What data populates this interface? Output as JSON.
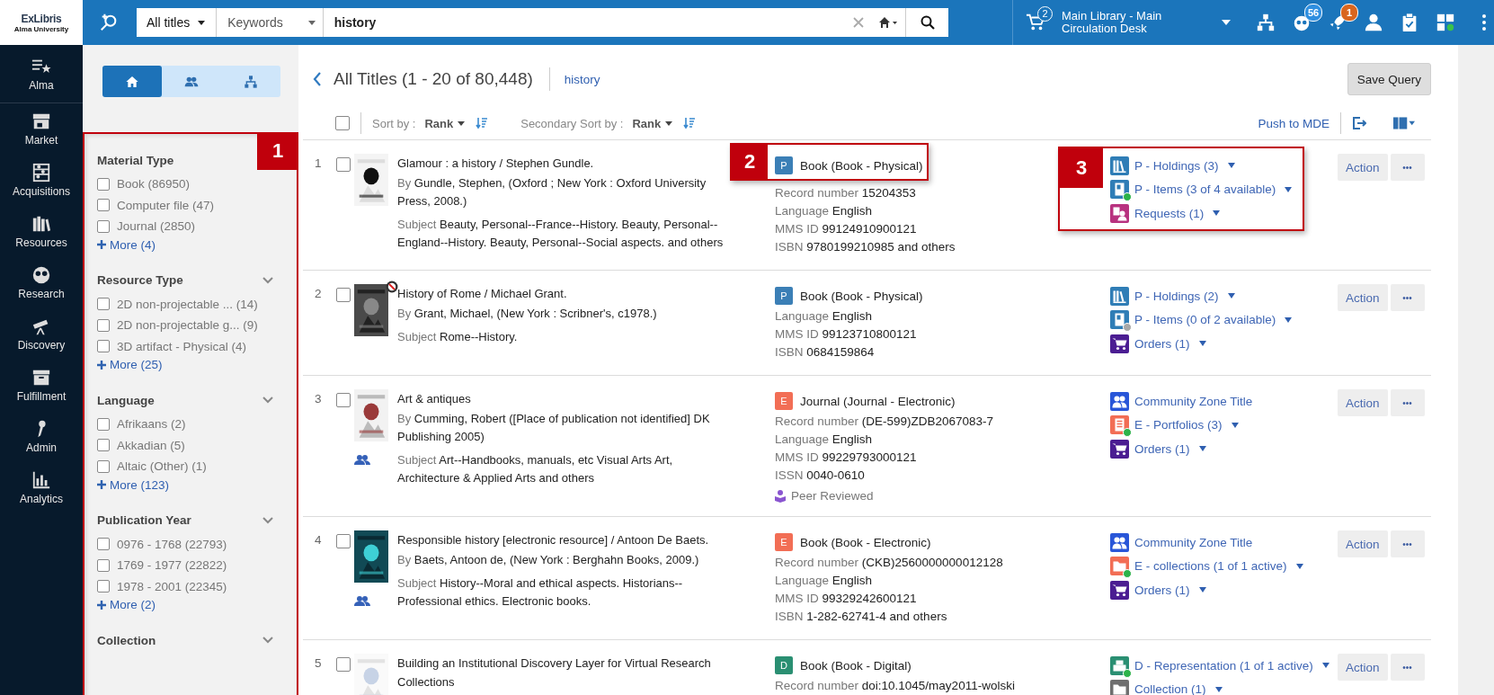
{
  "logo": {
    "brand": "ExLibris",
    "name": "Alma University"
  },
  "search": {
    "scope": "All titles",
    "field": "Keywords",
    "query": "history"
  },
  "cart": {
    "count": "2"
  },
  "location": "Main Library - Main Circulation Desk",
  "top_icons": [
    {
      "kind": "hierarchy"
    },
    {
      "kind": "avatar",
      "badge": "56"
    },
    {
      "kind": "rocket",
      "badge": "1"
    },
    {
      "kind": "person"
    },
    {
      "kind": "clipboard"
    },
    {
      "kind": "widgets"
    }
  ],
  "nav": [
    {
      "kind": "alma",
      "label": "Alma"
    },
    {
      "kind": "market",
      "label": "Market"
    },
    {
      "kind": "acquisitions",
      "label": "Acquisitions"
    },
    {
      "kind": "resources",
      "label": "Resources"
    },
    {
      "kind": "research",
      "label": "Research"
    },
    {
      "kind": "discovery",
      "label": "Discovery"
    },
    {
      "kind": "fulfillment",
      "label": "Fulfillment"
    },
    {
      "kind": "admin",
      "label": "Admin"
    },
    {
      "kind": "analytics",
      "label": "Analytics"
    }
  ],
  "scope_tabs": [
    {
      "kind": "home",
      "selected": true
    },
    {
      "kind": "people",
      "selected": false
    },
    {
      "kind": "hierarchy",
      "selected": false
    }
  ],
  "facets": {
    "callout": "1",
    "groups": [
      {
        "title": "Material Type",
        "chevron": false,
        "items": [
          {
            "label": "Book (86950)",
            "checked": false
          },
          {
            "label": "Computer file (47)",
            "checked": false
          },
          {
            "label": "Journal (2850)",
            "checked": false
          }
        ],
        "more": "More (4)"
      },
      {
        "title": "Resource Type",
        "chevron": true,
        "items": [
          {
            "label": "2D non-projectable ... (14)",
            "checked": false
          },
          {
            "label": "2D non-projectable g... (9)",
            "checked": false
          },
          {
            "label": "3D artifact - Physical (4)",
            "checked": false
          }
        ],
        "more": "More (25)"
      },
      {
        "title": "Language",
        "chevron": true,
        "items": [
          {
            "label": "Afrikaans (2)",
            "checked": false
          },
          {
            "label": "Akkadian (5)",
            "checked": false
          },
          {
            "label": "Altaic (Other) (1)",
            "checked": false
          }
        ],
        "more": "More (123)"
      },
      {
        "title": "Publication Year",
        "chevron": true,
        "items": [
          {
            "label": "0976 - 1768 (22793)",
            "checked": false
          },
          {
            "label": "1769 - 1977 (22822)",
            "checked": false
          },
          {
            "label": "1978 - 2001 (22345)",
            "checked": false
          }
        ],
        "more": "More (2)"
      },
      {
        "title": "Collection",
        "chevron": true
      }
    ]
  },
  "header": {
    "title": "All Titles (1 - 20 of 80,448)",
    "query": "history",
    "save": "Save Query"
  },
  "toolbar": {
    "select_all": false,
    "sort_label": "Sort by :",
    "sort_value": "Rank",
    "secondary_label": "Secondary Sort by :",
    "secondary_value": "Rank",
    "push": "Push to MDE"
  },
  "rows": [
    {
      "number": "1",
      "checked": false,
      "thumbnail": {
        "kind": "picture"
      },
      "blocked": false,
      "community_zone": false,
      "title": "Glamour : a history / Stephen Gundle.",
      "by_label": "By",
      "by": "Gundle, Stephen, (Oxford ; New York : Oxford University Press, 2008.)",
      "subject_label": "Subject",
      "subject": "Beauty, Personal--France--History. Beauty, Personal--England--History. Beauty, Personal--Social aspects. and others",
      "format": {
        "letter": "P",
        "color": "#3b7fb6",
        "text": "Book (Book - Physical)",
        "callout": "2"
      },
      "fields": [
        {
          "label": "Record number",
          "value": "15204353"
        },
        {
          "label": "Language",
          "value": "English"
        },
        {
          "label": "MMS ID",
          "value": "99124910900121"
        },
        {
          "label": "ISBN",
          "value": "9780199210985 and others"
        }
      ],
      "inventory_callout": "3",
      "inventory": [
        {
          "kind": "holdings",
          "text": "P - Holdings (3)",
          "dropdown": true
        },
        {
          "kind": "items",
          "text": "P - Items (3 of 4 available)",
          "dropdown": true,
          "color": "#2db34a"
        },
        {
          "kind": "requests",
          "text": "Requests (1)",
          "dropdown": true
        }
      ],
      "action": "Action",
      "more": "•••"
    },
    {
      "number": "2",
      "checked": false,
      "thumbnail": {
        "kind": "picture"
      },
      "blocked": true,
      "community_zone": false,
      "title": "History of Rome / Michael Grant.",
      "by_label": "By",
      "by": "Grant, Michael, (New York : Scribner's, c1978.)",
      "subject_label": "Subject",
      "subject": "Rome--History.",
      "format": {
        "letter": "P",
        "color": "#3b7fb6",
        "text": "Book (Book - Physical)"
      },
      "fields": [
        {
          "label": "Language",
          "value": "English"
        },
        {
          "label": "MMS ID",
          "value": "99123710800121"
        },
        {
          "label": "ISBN",
          "value": "0684159864"
        }
      ],
      "inventory": [
        {
          "kind": "holdings",
          "text": "P - Holdings (2)",
          "dropdown": true
        },
        {
          "kind": "items",
          "text": "P - Items (0 of 2 available)",
          "dropdown": true,
          "color": "#a8a8a8"
        },
        {
          "kind": "orders",
          "text": "Orders (1)",
          "dropdown": true
        }
      ],
      "action": "Action",
      "more": "•••"
    },
    {
      "number": "3",
      "checked": false,
      "thumbnail": {
        "kind": "picture"
      },
      "blocked": false,
      "community_zone": true,
      "title": "Art & antiques",
      "by_label": "By",
      "by": "Cumming, Robert ([Place of publication not identified] DK Publishing 2005)",
      "subject_label": "Subject",
      "subject": "Art--Handbooks, manuals, etc Visual Arts Art, Architecture & Applied Arts and others",
      "format": {
        "letter": "E",
        "color": "#f26e55",
        "text": "Journal (Journal - Electronic)"
      },
      "fields": [
        {
          "label": "Record number",
          "value": "(DE-599)ZDB2067083-7"
        },
        {
          "label": "Language",
          "value": "English"
        },
        {
          "label": "MMS ID",
          "value": "99229793000121"
        },
        {
          "label": "ISSN",
          "value": "0040-0610"
        }
      ],
      "peer_reviewed": "Peer Reviewed",
      "inventory": [
        {
          "kind": "community",
          "text": "Community Zone Title",
          "dropdown": false
        },
        {
          "kind": "portfolios",
          "text": "E - Portfolios (3)",
          "dropdown": true,
          "color": "#2db34a"
        },
        {
          "kind": "orders",
          "text": "Orders (1)",
          "dropdown": true
        }
      ],
      "action": "Action",
      "more": "•••"
    },
    {
      "number": "4",
      "checked": false,
      "thumbnail": {
        "kind": "picture"
      },
      "blocked": false,
      "community_zone": true,
      "title": "Responsible history [electronic resource] / Antoon De Baets.",
      "by_label": "By",
      "by": "Baets, Antoon de, (New York : Berghahn Books, 2009.)",
      "subject_label": "Subject",
      "subject": "History--Moral and ethical aspects. Historians--Professional ethics. Electronic books.",
      "format": {
        "letter": "E",
        "color": "#f26e55",
        "text": "Book (Book - Electronic)"
      },
      "fields": [
        {
          "label": "Record number",
          "value": "(CKB)2560000000012128"
        },
        {
          "label": "Language",
          "value": "English"
        },
        {
          "label": "MMS ID",
          "value": "99329242600121"
        },
        {
          "label": "ISBN",
          "value": "1-282-62741-4 and others"
        }
      ],
      "inventory": [
        {
          "kind": "community",
          "text": "Community Zone Title",
          "dropdown": false
        },
        {
          "kind": "collections",
          "text": "E - collections (1 of 1 active)",
          "dropdown": true,
          "color": "#2db34a"
        },
        {
          "kind": "orders",
          "text": "Orders (1)",
          "dropdown": true
        }
      ],
      "action": "Action",
      "more": "•••"
    },
    {
      "number": "5",
      "checked": false,
      "thumbnail": {
        "kind": "picture"
      },
      "blocked": false,
      "community_zone": false,
      "title": "Building an Institutional Discovery Layer for Virtual Research Collections",
      "format": {
        "letter": "D",
        "color": "#2a8f72",
        "text": "Book (Book - Digital)"
      },
      "fields": [
        {
          "label": "Record number",
          "value": "doi:10.1045/may2011-wolski"
        }
      ],
      "inventory": [
        {
          "kind": "representation",
          "text": "D - Representation (1 of 1 active)",
          "dropdown": true,
          "color": "#2db34a"
        },
        {
          "kind": "collection",
          "text": "Collection (1)",
          "dropdown": true
        }
      ],
      "action": "Action",
      "more": "•••"
    }
  ]
}
